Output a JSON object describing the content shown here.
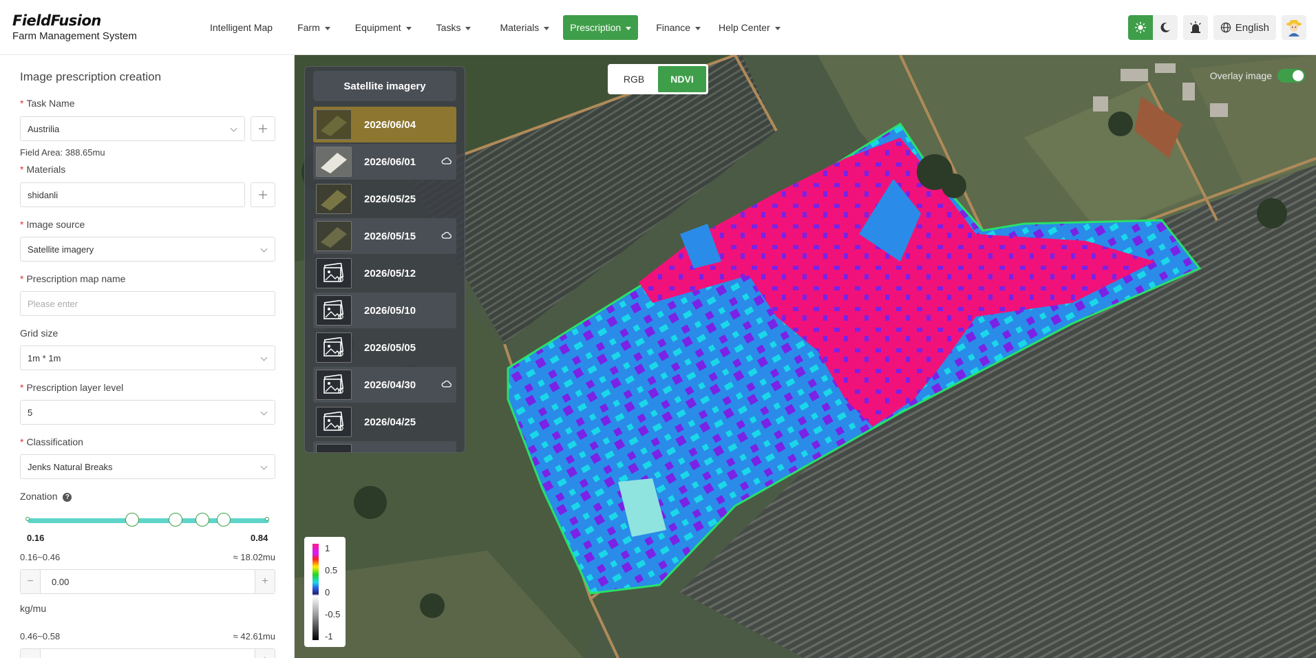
{
  "header": {
    "brand": "FieldFusion",
    "subtitle": "Farm Management System",
    "nav": [
      {
        "label": "Intelligent Map",
        "caret": false,
        "active": false
      },
      {
        "label": "Farm",
        "caret": true,
        "active": false
      },
      {
        "label": "Equipment",
        "caret": true,
        "active": false
      },
      {
        "label": "Tasks",
        "caret": true,
        "active": false
      },
      {
        "label": "Materials",
        "caret": true,
        "active": false
      },
      {
        "label": "Prescription",
        "caret": true,
        "active": true
      },
      {
        "label": "Finance",
        "caret": true,
        "active": false
      },
      {
        "label": "Help Center",
        "caret": true,
        "active": false
      }
    ],
    "language": "English",
    "accent": "#3f9e4a"
  },
  "panel": {
    "title": "Image prescription creation",
    "task_name_label": "Task Name",
    "task_name_value": "Austrilia",
    "field_area": "Field Area: 388.65mu",
    "materials_label": "Materials",
    "materials_value": "shidanli",
    "image_source_label": "Image source",
    "image_source_value": "Satellite imagery",
    "map_name_label": "Prescription map name",
    "map_name_placeholder": "Please enter",
    "grid_size_label": "Grid size",
    "grid_size_value": "1m * 1m",
    "layer_level_label": "Prescription layer level",
    "layer_level_value": "5",
    "classification_label": "Classification",
    "classification_value": "Jenks Natural Breaks",
    "zonation_label": "Zonation",
    "slider_min": "0.16",
    "slider_max": "0.84",
    "zones": [
      {
        "range": "0.16~0.46",
        "area": "≈ 18.02mu",
        "value": "0.00",
        "unit": "kg/mu"
      },
      {
        "range": "0.46~0.58",
        "area": "≈ 42.61mu"
      }
    ]
  },
  "map": {
    "imagery_header": "Satellite imagery",
    "dates": [
      {
        "date": "2026/06/04",
        "cloud": false,
        "selected": true
      },
      {
        "date": "2026/06/01",
        "cloud": true,
        "selected": false
      },
      {
        "date": "2026/05/25",
        "cloud": false,
        "selected": false
      },
      {
        "date": "2026/05/15",
        "cloud": true,
        "selected": false
      },
      {
        "date": "2026/05/12",
        "cloud": false,
        "selected": false
      },
      {
        "date": "2026/05/10",
        "cloud": false,
        "selected": false
      },
      {
        "date": "2026/05/05",
        "cloud": false,
        "selected": false
      },
      {
        "date": "2026/04/30",
        "cloud": true,
        "selected": false
      },
      {
        "date": "2026/04/25",
        "cloud": false,
        "selected": false
      }
    ],
    "mode_rgb": "RGB",
    "mode_ndvi": "NDVI",
    "overlay_label": "Overlay image",
    "legend": [
      "1",
      "0.5",
      "0",
      "-0.5",
      "-1"
    ]
  }
}
